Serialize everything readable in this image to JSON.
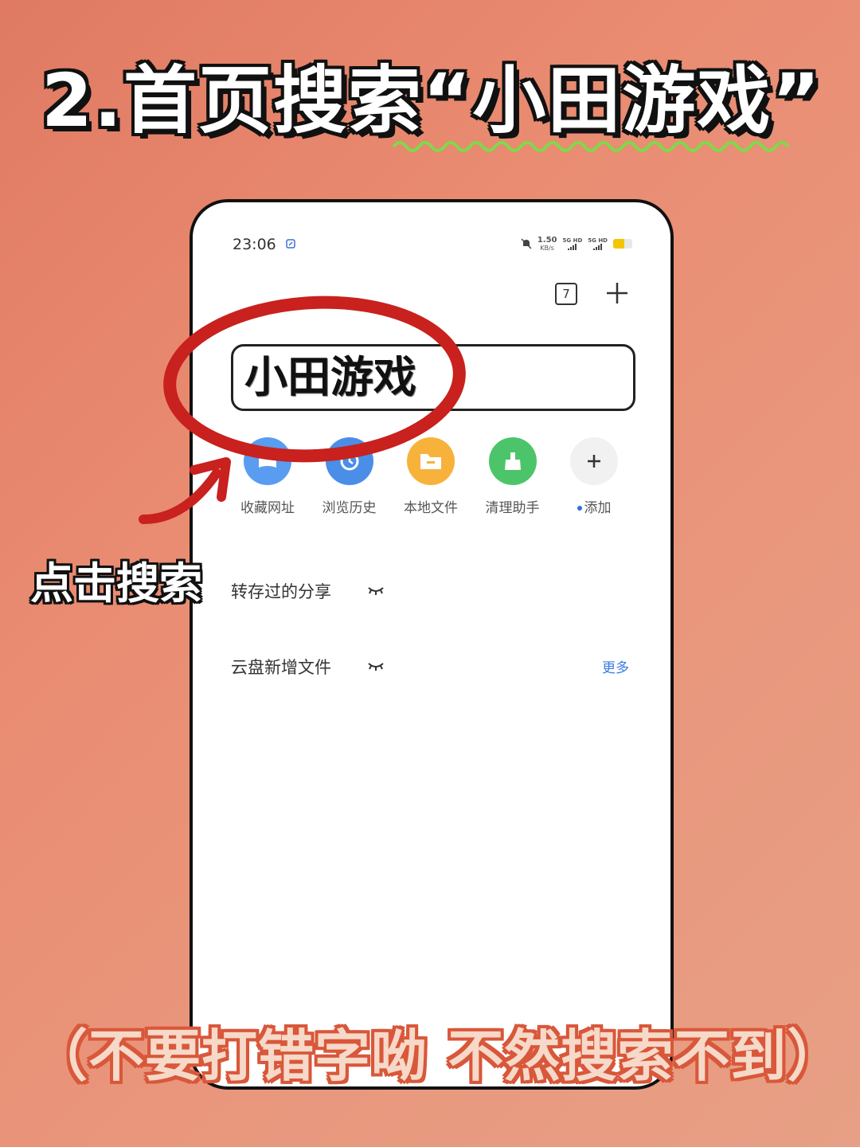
{
  "header": {
    "title": "2.首页搜索“小田游戏”"
  },
  "status_bar": {
    "time": "23:06",
    "net_speed_value": "1.50",
    "net_speed_unit": "KB/s",
    "sim1_label": "5G HD",
    "sim2_label": "5G HD",
    "battery_level": 0.6
  },
  "toolbar": {
    "tab_count": "7",
    "add_icon": "plus-icon"
  },
  "search": {
    "value": "小田游戏"
  },
  "shortcuts": [
    {
      "label": "收藏网址",
      "icon": "bookmark-icon",
      "color": "#5a9cf0"
    },
    {
      "label": "浏览历史",
      "icon": "history-icon",
      "color": "#4a8ee8"
    },
    {
      "label": "本地文件",
      "icon": "folder-icon",
      "color": "#f7b23c"
    },
    {
      "label": "清理助手",
      "icon": "broom-icon",
      "color": "#4cc56a"
    },
    {
      "label": "添加",
      "icon": "plus-icon",
      "color": "#f1f1f1"
    }
  ],
  "sections": {
    "saved_shares": {
      "title": "转存过的分享",
      "icon": "eye-closed-icon"
    },
    "cloud_new_files": {
      "title": "云盘新增文件",
      "icon": "eye-closed-icon",
      "more": "更多"
    }
  },
  "annotations": {
    "click_search": "点击搜索",
    "bottom_note": "（不要打错字呦 不然搜索不到）",
    "circle_color": "#c8211e",
    "underline_color": "#7fd94a"
  }
}
